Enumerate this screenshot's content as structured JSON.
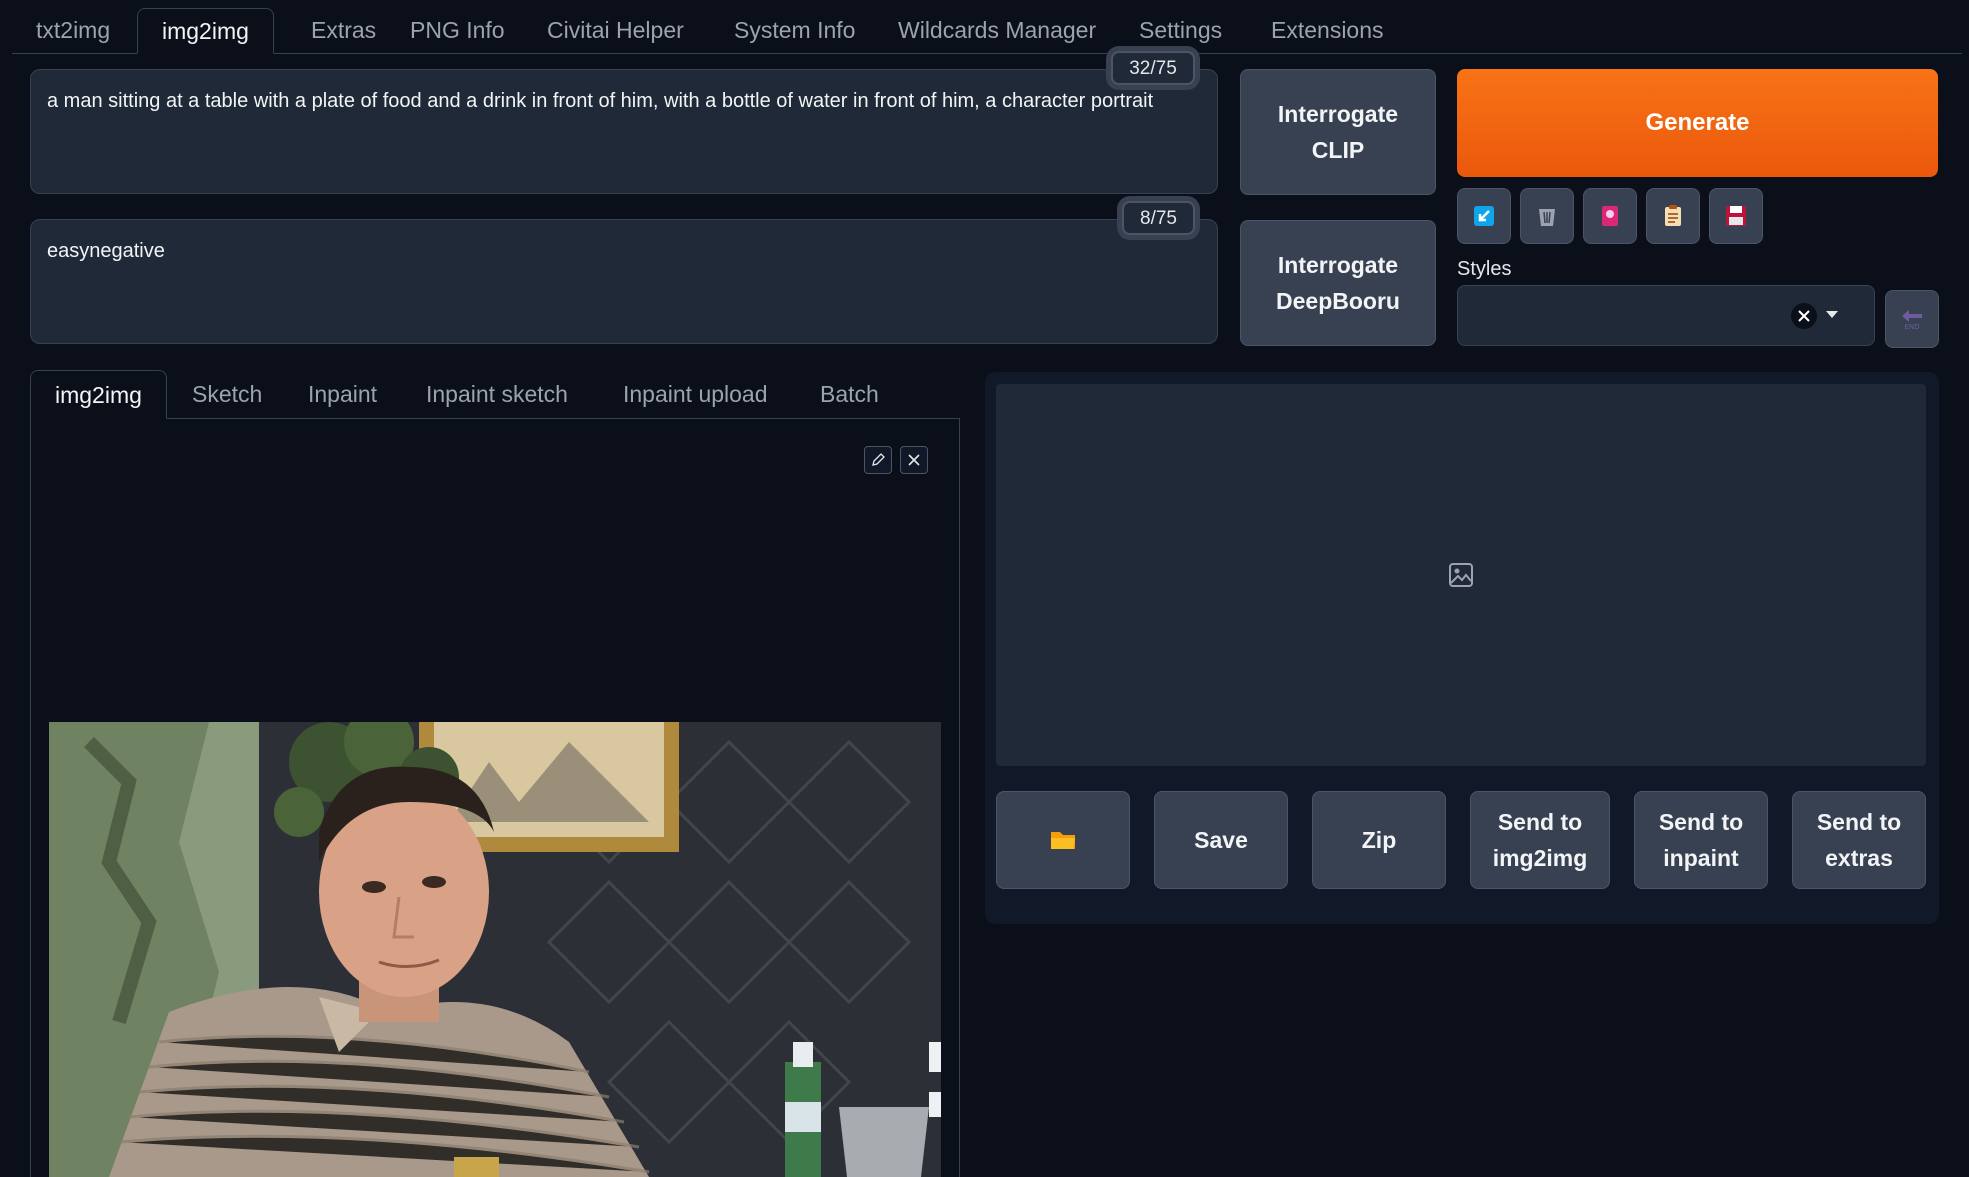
{
  "nav": {
    "tabs": [
      "txt2img",
      "img2img",
      "Extras",
      "PNG Info",
      "Civitai Helper",
      "System Info",
      "Wildcards Manager",
      "Settings",
      "Extensions"
    ],
    "active": "img2img"
  },
  "prompt": {
    "text": "a man sitting at a table with a plate of food and a drink in front of him, with a bottle of water in front of him, a character portrait",
    "token_count": "32/75"
  },
  "negative_prompt": {
    "text": "easynegative",
    "token_count": "8/75"
  },
  "buttons": {
    "interrogate_clip": "Interrogate CLIP",
    "interrogate_deepbooru": "Interrogate DeepBooru",
    "generate": "Generate"
  },
  "tools": [
    "paste-icon",
    "trash-icon",
    "extra-networks-icon",
    "clipboard-icon",
    "save-style-icon"
  ],
  "styles": {
    "label": "Styles",
    "value": ""
  },
  "img_tabs": {
    "tabs": [
      "img2img",
      "Sketch",
      "Inpaint",
      "Inpaint sketch",
      "Inpaint upload",
      "Batch"
    ],
    "active": "img2img"
  },
  "output_buttons": {
    "folder": "folder-icon",
    "save": "Save",
    "zip": "Zip",
    "send_img2img": "Send to img2img",
    "send_inpaint": "Send to inpaint",
    "send_extras": "Send to extras"
  },
  "colors": {
    "background": "#0b0f19",
    "panel": "#1f2937",
    "accent": "#f97316"
  }
}
